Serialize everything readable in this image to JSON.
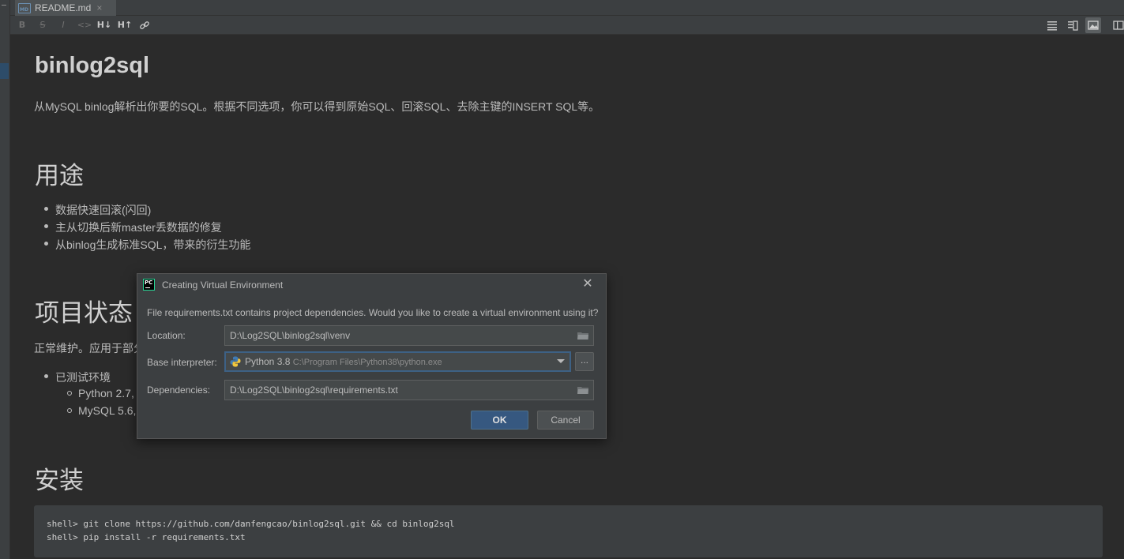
{
  "tab": {
    "filename": "README.md",
    "icon": "markdown-file-icon",
    "close": "×"
  },
  "toolbar": {
    "bold": "B",
    "strike": "S",
    "italic": "I",
    "code": "<>",
    "h_down": "H↓",
    "h_up": "H↑"
  },
  "doc": {
    "title": "binlog2sql",
    "intro": "从MySQL binlog解析出你要的SQL。根据不同选项，你可以得到原始SQL、回滚SQL、去除主键的INSERT SQL等。",
    "sections": [
      {
        "heading": "用途"
      },
      {
        "heading": "项目状态"
      },
      {
        "heading": "安装"
      }
    ],
    "uses": [
      "数据快速回滚(闪回)",
      "主从切换后新master丢数据的修复",
      "从binlog生成标准SQL，带来的衍生功能"
    ],
    "status_text": "正常维护。应用于部分",
    "tested_env": "已测试环境",
    "tested_items": [
      "Python 2.7,",
      "MySQL 5.6,"
    ],
    "install_code": [
      "shell> git clone https://github.com/danfengcao/binlog2sql.git && cd binlog2sql",
      "shell> pip install -r requirements.txt"
    ]
  },
  "dialog": {
    "title": "Creating Virtual Environment",
    "message": "File requirements.txt contains project dependencies. Would you like to create a virtual environment using it?",
    "location_label": "Location:",
    "location_value": "D:\\Log2SQL\\binlog2sql\\venv",
    "interpreter_label": "Base interpreter:",
    "interpreter_name": "Python 3.8",
    "interpreter_path": "C:\\Program Files\\Python38\\python.exe",
    "dependencies_label": "Dependencies:",
    "dependencies_value": "D:\\Log2SQL\\binlog2sql\\requirements.txt",
    "browse_label": "...",
    "ok_label": "OK",
    "cancel_label": "Cancel",
    "close_glyph": "✕"
  },
  "colors": {
    "accent": "#365880",
    "focus": "#3d6185",
    "background": "#2b2b2b",
    "panel": "#3c3f41"
  }
}
